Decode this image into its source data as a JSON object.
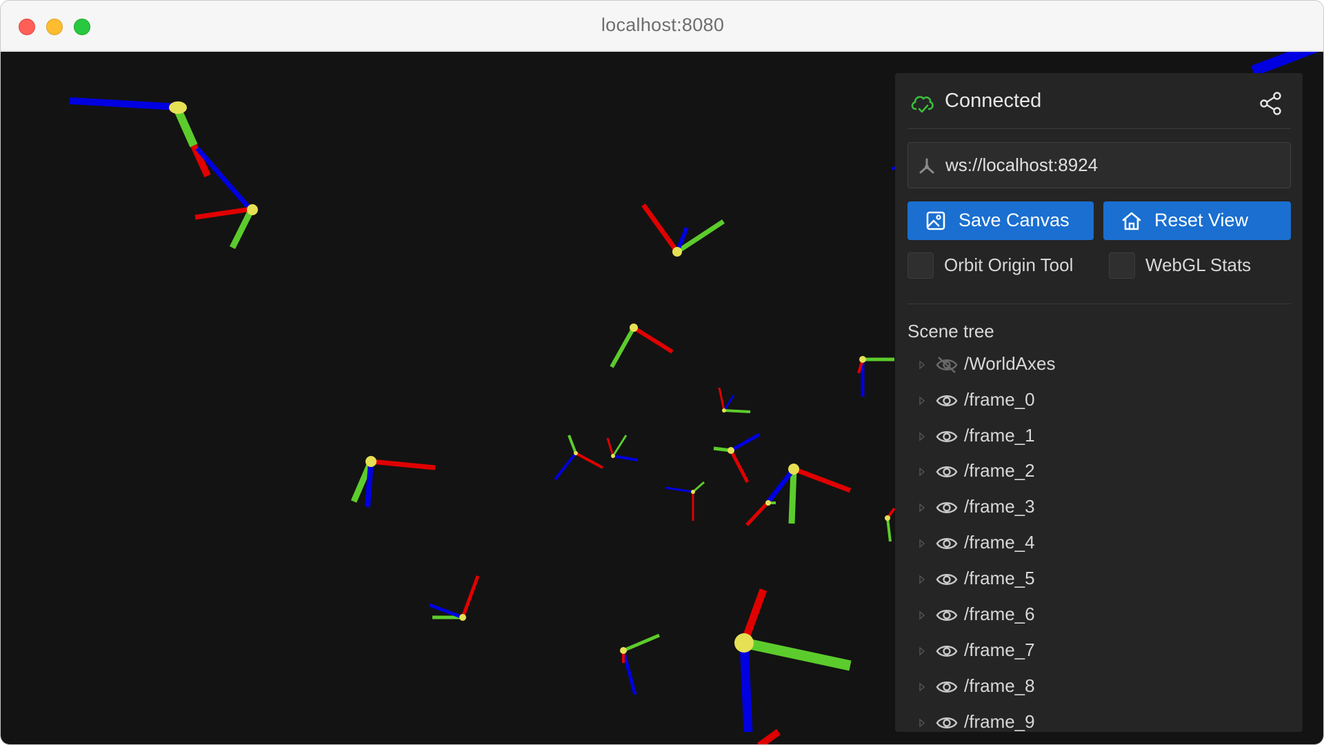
{
  "window": {
    "title": "localhost:8080"
  },
  "connection": {
    "status_label": "Connected",
    "status_color": "#3cbf3c",
    "status_icon": "cloud-check-icon",
    "share_icon": "share-icon",
    "server_url": "ws://localhost:8924",
    "url_icon": "robot-arm-icon"
  },
  "actions": {
    "save_canvas_label": "Save Canvas",
    "save_canvas_icon": "image-icon",
    "reset_view_label": "Reset View",
    "reset_view_icon": "home-icon",
    "accent_color": "#1a6fd0"
  },
  "toggles": [
    {
      "label": "Orbit Origin Tool",
      "checked": false
    },
    {
      "label": "WebGL Stats",
      "checked": false
    }
  ],
  "scene_tree": {
    "title": "Scene tree",
    "items": [
      {
        "label": "/WorldAxes",
        "visible": false,
        "icon": "eye-off-icon"
      },
      {
        "label": "/frame_0",
        "visible": true,
        "icon": "eye-icon"
      },
      {
        "label": "/frame_1",
        "visible": true,
        "icon": "eye-icon"
      },
      {
        "label": "/frame_2",
        "visible": true,
        "icon": "eye-icon"
      },
      {
        "label": "/frame_3",
        "visible": true,
        "icon": "eye-icon"
      },
      {
        "label": "/frame_4",
        "visible": true,
        "icon": "eye-icon"
      },
      {
        "label": "/frame_5",
        "visible": true,
        "icon": "eye-icon"
      },
      {
        "label": "/frame_6",
        "visible": true,
        "icon": "eye-icon"
      },
      {
        "label": "/frame_7",
        "visible": true,
        "icon": "eye-icon"
      },
      {
        "label": "/frame_8",
        "visible": true,
        "icon": "eye-icon"
      },
      {
        "label": "/frame_9",
        "visible": true,
        "icon": "eye-icon"
      }
    ]
  },
  "viewport": {
    "background": "#131313",
    "axis_colors": {
      "x": "#e00000",
      "y": "#5ccc2c",
      "z": "#0000e0",
      "origin": "#e6e055"
    }
  }
}
